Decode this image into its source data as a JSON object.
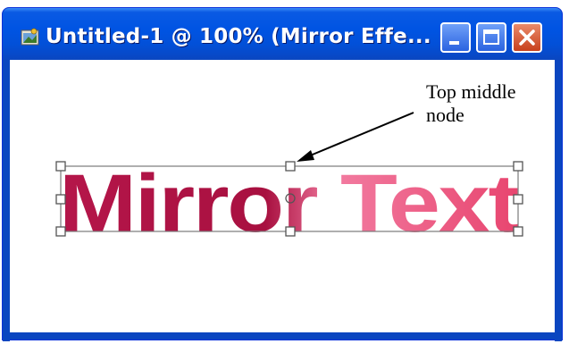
{
  "window": {
    "title": "Untitled-1 @ 100% (Mirror Effe...",
    "colors": {
      "titlebar": "#0054e3",
      "close": "#c8401c"
    }
  },
  "canvas": {
    "text_left": "Mirror",
    "text_right": "Text",
    "gradient_dark": "#b5164a",
    "gradient_light": "#f9a7c1"
  },
  "annotation": {
    "label_line1": "Top middle",
    "label_line2": "node"
  },
  "icons": [
    "app-icon",
    "minimize-icon",
    "maximize-icon",
    "close-icon"
  ]
}
